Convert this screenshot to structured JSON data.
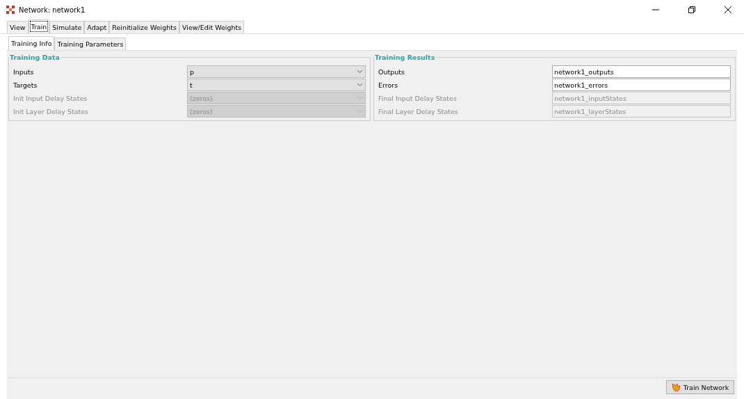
{
  "window": {
    "title": "Network: network1"
  },
  "tabs": [
    {
      "label": "View",
      "selected": false
    },
    {
      "label": "Train",
      "selected": true
    },
    {
      "label": "Simulate",
      "selected": false
    },
    {
      "label": "Adapt",
      "selected": false
    },
    {
      "label": "Reinitialize Weights",
      "selected": false
    },
    {
      "label": "View/Edit Weights",
      "selected": false
    }
  ],
  "subtabs": [
    {
      "label": "Training Info",
      "selected": true
    },
    {
      "label": "Training Parameters",
      "selected": false
    }
  ],
  "training_data": {
    "title": "Training Data",
    "rows": [
      {
        "label": "Inputs",
        "value": "p",
        "disabled": false
      },
      {
        "label": "Targets",
        "value": "t",
        "disabled": false
      },
      {
        "label": "Init Input Delay States",
        "value": "(zeros)",
        "disabled": true
      },
      {
        "label": "Init Layer Delay States",
        "value": "(zeros)",
        "disabled": true
      }
    ]
  },
  "training_results": {
    "title": "Training Results",
    "rows": [
      {
        "label": "Outputs",
        "value": "network1_outputs",
        "disabled": false
      },
      {
        "label": "Errors",
        "value": "network1_errors",
        "disabled": false
      },
      {
        "label": "Final Input Delay States",
        "value": "network1_inputStates",
        "disabled": true
      },
      {
        "label": "Final Layer Delay States",
        "value": "network1_layerStates",
        "disabled": true
      }
    ]
  },
  "train_button": {
    "label": "Train Network"
  }
}
